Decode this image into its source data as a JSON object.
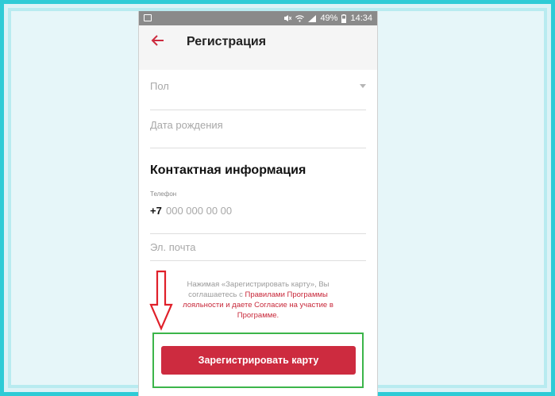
{
  "status_bar": {
    "battery_percent": "49%",
    "time": "14:34"
  },
  "app_bar": {
    "title": "Регистрация"
  },
  "form": {
    "gender_placeholder": "Пол",
    "birthdate_placeholder": "Дата рождения",
    "contact_section_title": "Контактная информация",
    "phone_label": "Телефон",
    "phone_prefix": "+7",
    "phone_placeholder": "000 000 00 00",
    "email_placeholder": "Эл. почта"
  },
  "consent": {
    "text_before": "Нажимая «Зарегистрировать карту», Вы соглашаетесь с ",
    "rules_link": "Правилами Программы лояльности",
    "text_middle": " и даете ",
    "agreement_link": "Согласие на участие в Программе."
  },
  "register_button_label": "Зарегистрировать карту",
  "colors": {
    "accent": "#cd2b3f",
    "frame": "#2ecbd6",
    "highlight": "#3bb54a"
  }
}
